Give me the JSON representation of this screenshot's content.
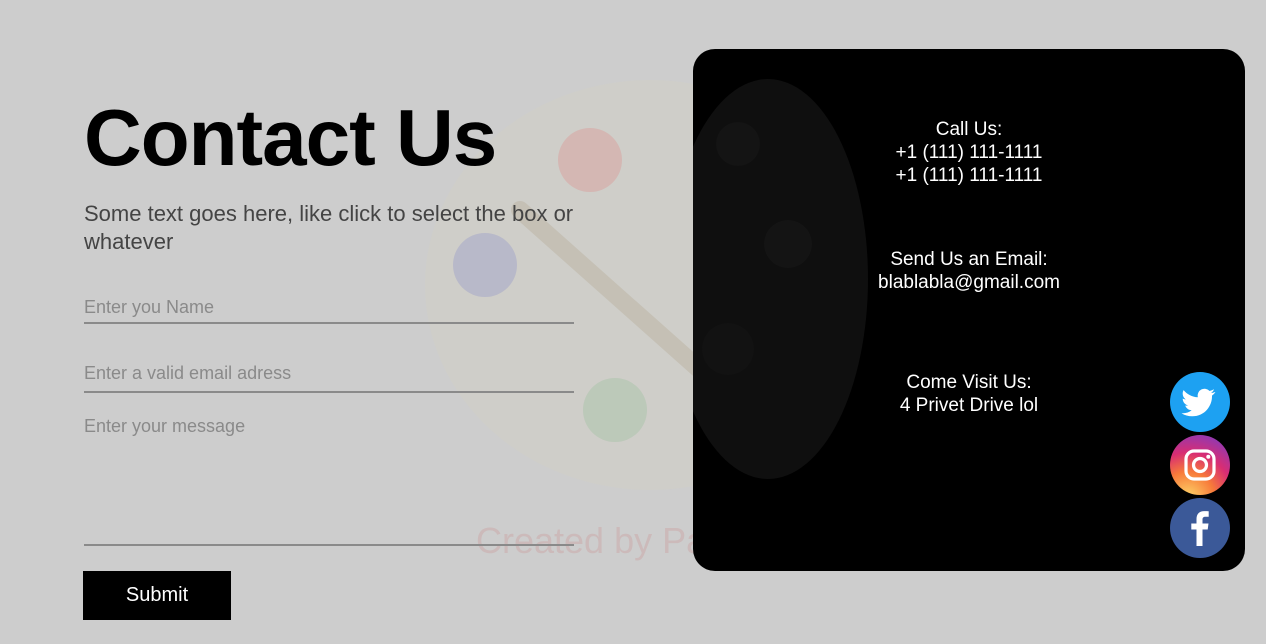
{
  "page": {
    "title": "Contact Us",
    "subtitle": "Some text goes here, like click to select the box or whatever",
    "watermark": "Created by Paint S"
  },
  "form": {
    "name_placeholder": "Enter you Name",
    "email_placeholder": "Enter a valid email adress",
    "message_placeholder": "Enter your message",
    "submit_label": "Submit"
  },
  "contact": {
    "call": {
      "heading": "Call Us:",
      "phone1": "+1 (111) 111-1111",
      "phone2": "+1 (111) 111-1111"
    },
    "email": {
      "heading": "Send Us an Email:",
      "address": "blablabla@gmail.com"
    },
    "visit": {
      "heading": "Come Visit Us:",
      "address": "4 Privet Drive lol"
    }
  },
  "social": [
    {
      "icon": "twitter-icon",
      "color": "#1da1f2"
    },
    {
      "icon": "instagram-icon",
      "color": "#d82d73"
    },
    {
      "icon": "facebook-icon",
      "color": "#3b5998"
    }
  ],
  "colors": {
    "background": "#cdcdcd",
    "card": "#000000",
    "button": "#000000",
    "text": "#000000"
  }
}
